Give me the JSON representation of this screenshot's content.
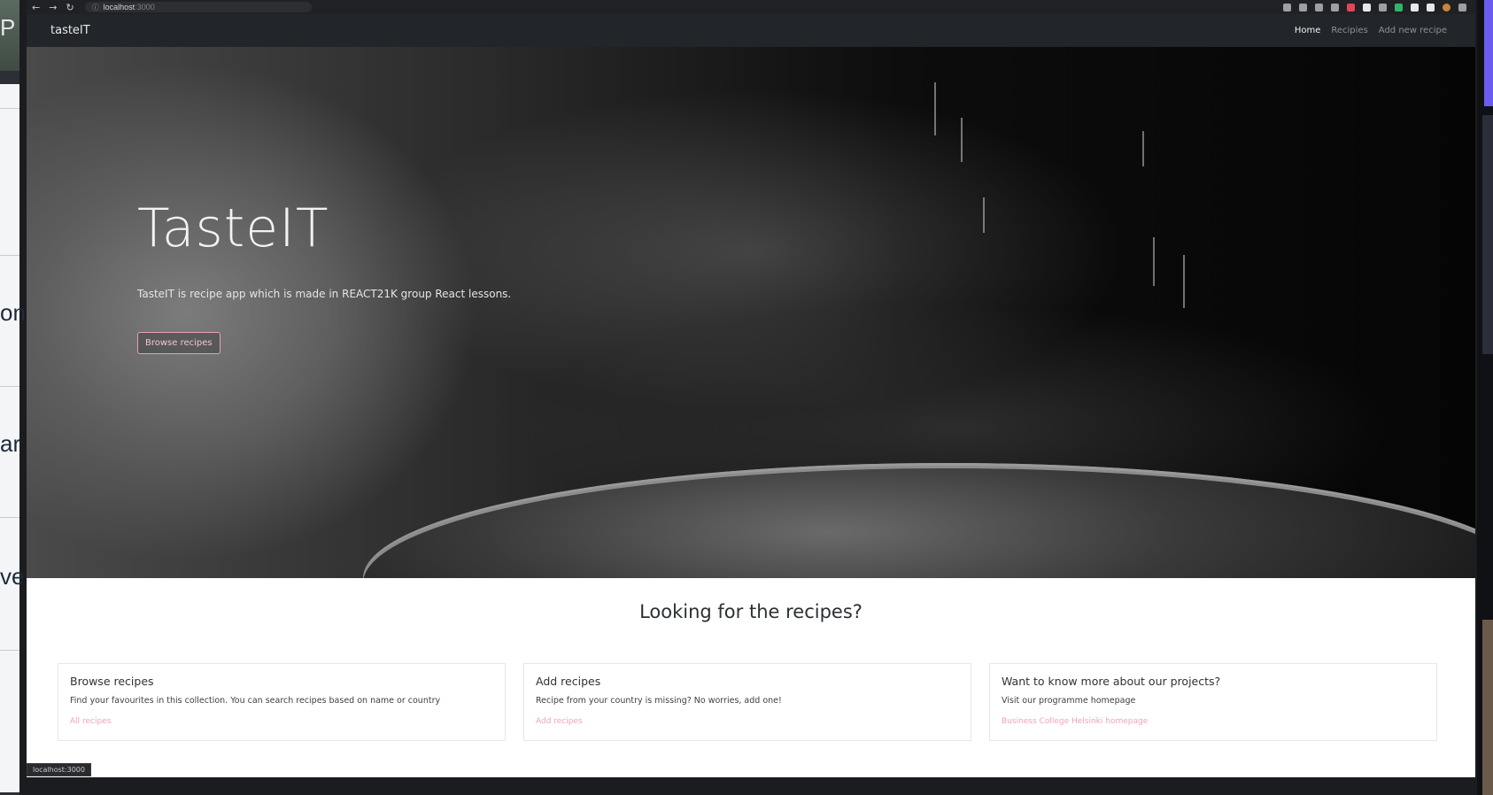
{
  "browser": {
    "url_host": "localhost",
    "url_port": ":3000",
    "status_bar_url": "localhost:3000"
  },
  "navbar": {
    "brand": "tasteIT",
    "links": [
      "Home",
      "Recipies",
      "Add new recipe"
    ],
    "active": "Home"
  },
  "hero": {
    "title": "TasteIT",
    "subtitle": "TasteIT is recipe app which is made in REACT21K group React lessons.",
    "button": "Browse recipes"
  },
  "section": {
    "title": "Looking for the recipes?",
    "cards": [
      {
        "title": "Browse recipes",
        "text": "Find your favourites in this collection. You can search recipes based on name or country",
        "link": "All recipes"
      },
      {
        "title": "Add recipes",
        "text": "Recipe from your country is missing? No worries, add one!",
        "link": "Add recipes"
      },
      {
        "title": "Want to know more about our projects?",
        "text": "Visit our programme homepage",
        "link": "Business College Helsinki homepage"
      }
    ]
  },
  "background_fragments": [
    "P",
    "on",
    "ar",
    "ve"
  ],
  "colors": {
    "navbar_bg": "#222529",
    "accent_pink": "#f1a3b5",
    "page_bg": "#ffffff"
  }
}
